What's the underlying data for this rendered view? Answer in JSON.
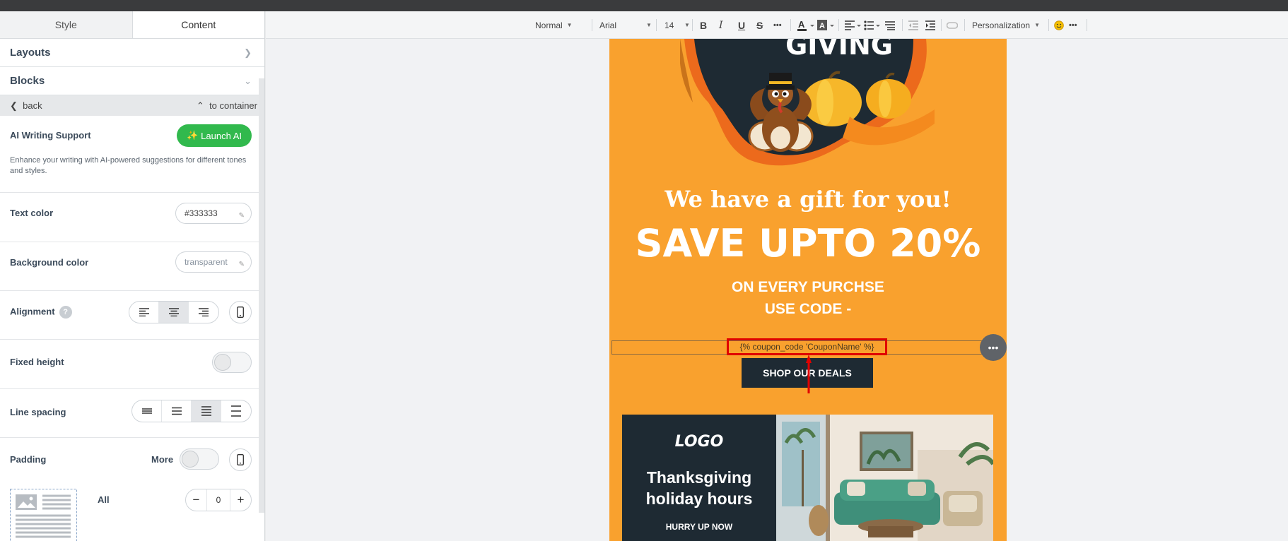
{
  "sidebar": {
    "tabs": [
      {
        "label": "Style"
      },
      {
        "label": "Content"
      }
    ],
    "sections": [
      {
        "label": "Layouts"
      },
      {
        "label": "Blocks"
      }
    ],
    "nav": {
      "back": "back",
      "to_container": "to container"
    },
    "ai": {
      "title": "AI Writing Support",
      "button": "Launch AI",
      "description": "Enhance your writing with AI-powered suggestions for different tones and styles."
    },
    "text_color": {
      "label": "Text color",
      "value": "#333333"
    },
    "background_color": {
      "label": "Background color",
      "value": "transparent"
    },
    "alignment": {
      "label": "Alignment",
      "help": "?",
      "selected": "center"
    },
    "fixed_height": {
      "label": "Fixed height",
      "enabled": false
    },
    "line_spacing": {
      "label": "Line spacing",
      "selected": 3
    },
    "padding": {
      "label": "Padding",
      "more_label": "More",
      "all_label": "All",
      "all_value": "0",
      "minus": "−",
      "plus": "+"
    }
  },
  "toolbar": {
    "paragraph_format": "Normal",
    "font_family": "Arial",
    "font_size": "14",
    "personalization": "Personalization",
    "bold": "B",
    "italic": "I",
    "underline": "U",
    "strike": "S",
    "more": "•••"
  },
  "email": {
    "gift_heading": "We have a gift for you!",
    "save_heading": "SAVE UPTO 20%",
    "line1": "ON EVERY PURCHSE",
    "line2": "USE CODE -",
    "coupon_code": "{% coupon_code 'CouponName' %}",
    "shop_button": "SHOP OUR DEALS",
    "hero_text": "GIVING",
    "promo": {
      "logo": "LOGO",
      "title_line1": "Thanksgiving",
      "title_line2": "holiday hours",
      "cta": "HURRY UP NOW"
    }
  },
  "colors": {
    "accent_green": "#31b94d",
    "email_bg": "#f9a12e",
    "dark_navy": "#1e2a33",
    "highlight_red": "#e00000"
  }
}
